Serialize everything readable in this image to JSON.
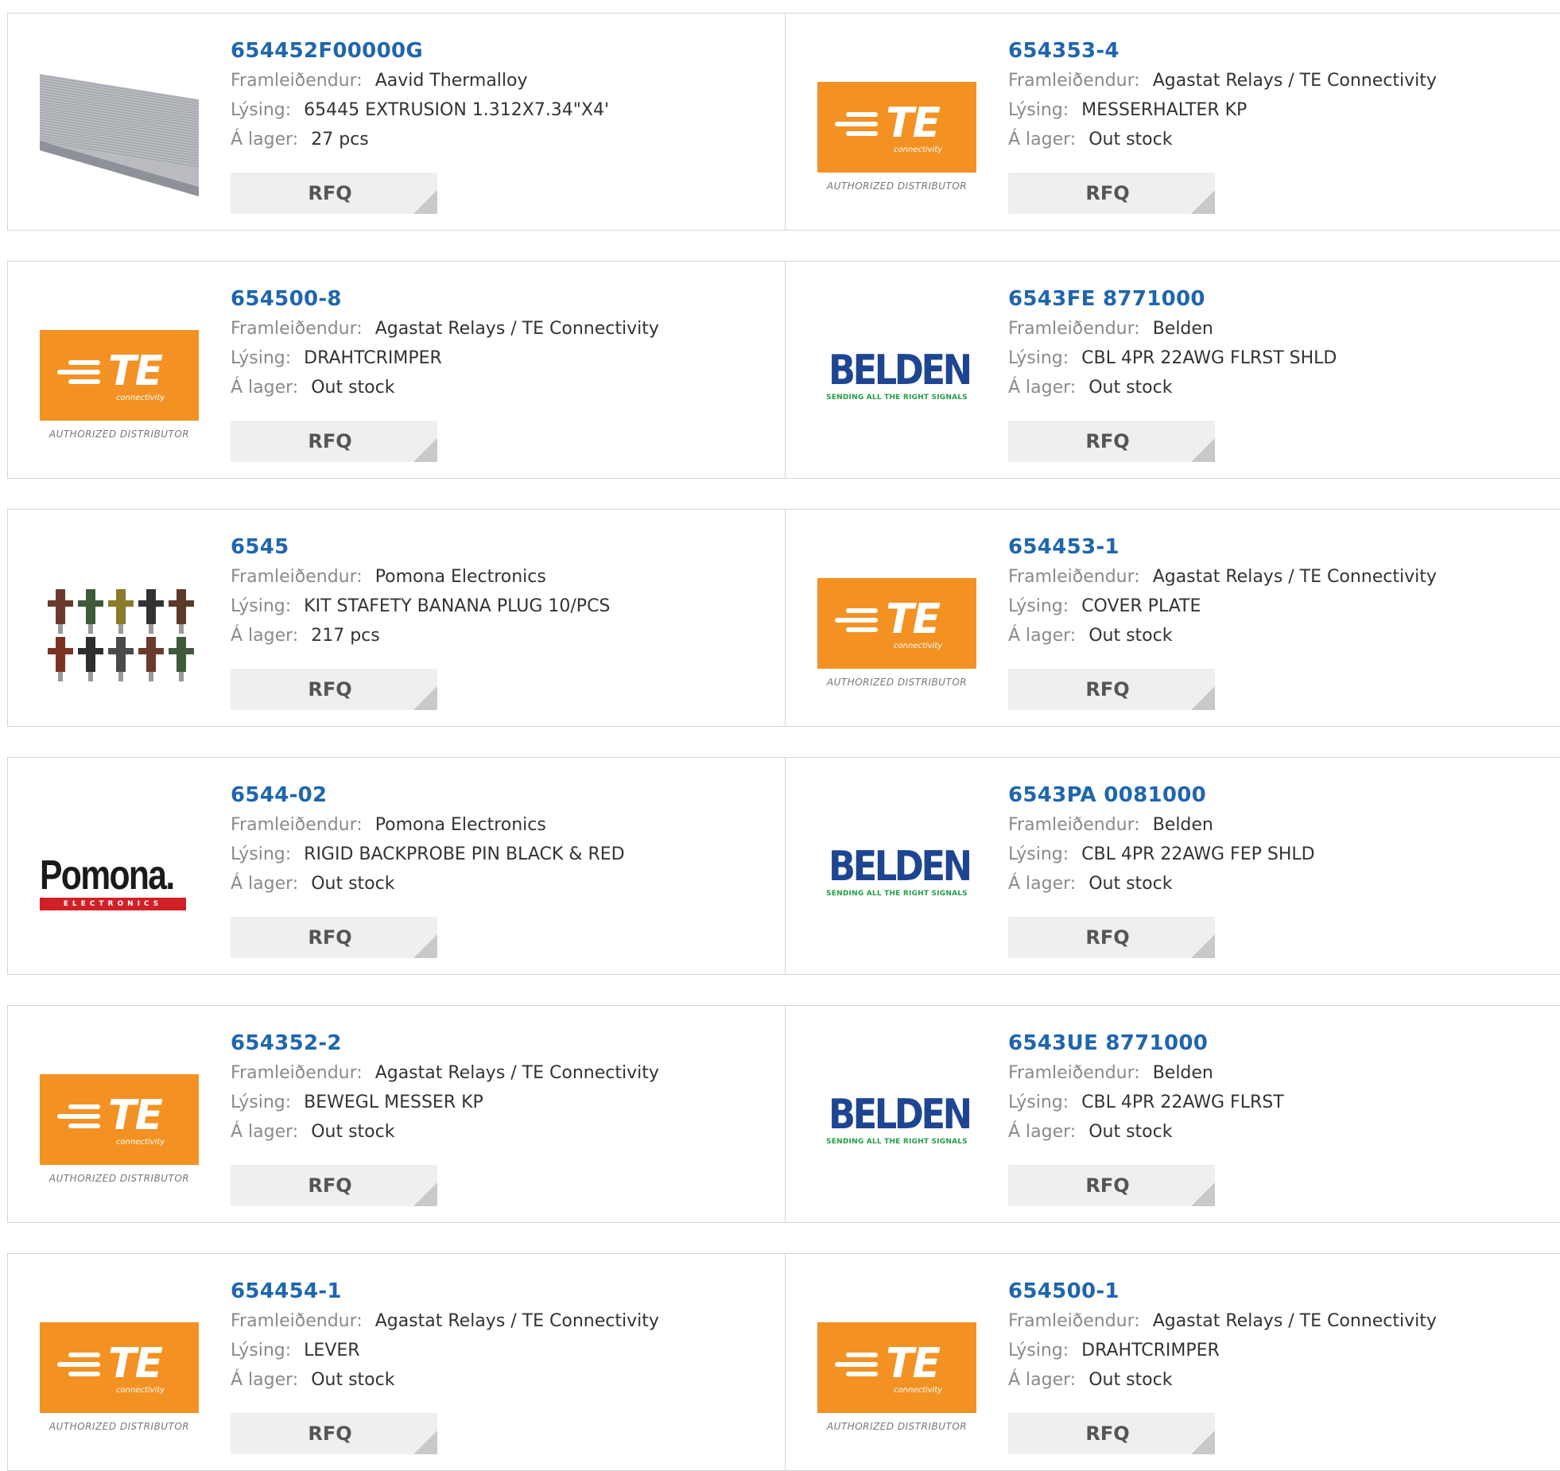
{
  "labels": {
    "manufacturer": "Framleiðendur:",
    "description": "Lýsing:",
    "stock": "Á lager:",
    "rfq": "RFQ"
  },
  "logos": {
    "te": {
      "word": "TE",
      "sub": "connectivity",
      "caption": "AUTHORIZED DISTRIBUTOR"
    },
    "belden": {
      "word": "BELDEN",
      "sub": "SENDING ALL THE RIGHT SIGNALS"
    },
    "pomona": {
      "word": "Pomona.",
      "sub": "ELECTRONICS"
    }
  },
  "products": [
    {
      "pn": "654452F00000G",
      "manufacturer": "Aavid Thermalloy",
      "description": "65445 EXTRUSION 1.312X7.34\"X4'",
      "stock": "27 pcs",
      "image": "heatsink-extrusion"
    },
    {
      "pn": "654353-4",
      "manufacturer": "Agastat Relays / TE Connectivity",
      "description": "MESSERHALTER KP",
      "stock": "Out stock",
      "image": "te-logo"
    },
    {
      "pn": "654500-8",
      "manufacturer": "Agastat Relays / TE Connectivity",
      "description": "DRAHTCRIMPER",
      "stock": "Out stock",
      "image": "te-logo"
    },
    {
      "pn": "6543FE 8771000",
      "manufacturer": "Belden",
      "description": "CBL 4PR 22AWG FLRST SHLD",
      "stock": "Out stock",
      "image": "belden-logo"
    },
    {
      "pn": "6545",
      "manufacturer": "Pomona Electronics",
      "description": "KIT STAFETY BANANA PLUG 10/PCS",
      "stock": "217 pcs",
      "image": "banana-plugs"
    },
    {
      "pn": "654453-1",
      "manufacturer": "Agastat Relays / TE Connectivity",
      "description": "COVER PLATE",
      "stock": "Out stock",
      "image": "te-logo"
    },
    {
      "pn": "6544-02",
      "manufacturer": "Pomona Electronics",
      "description": "RIGID BACKPROBE PIN BLACK & RED",
      "stock": "Out stock",
      "image": "pomona-logo"
    },
    {
      "pn": "6543PA 0081000",
      "manufacturer": "Belden",
      "description": "CBL 4PR 22AWG FEP SHLD",
      "stock": "Out stock",
      "image": "belden-logo"
    },
    {
      "pn": "654352-2",
      "manufacturer": "Agastat Relays / TE Connectivity",
      "description": "BEWEGL MESSER KP",
      "stock": "Out stock",
      "image": "te-logo"
    },
    {
      "pn": "6543UE 8771000",
      "manufacturer": "Belden",
      "description": "CBL 4PR 22AWG FLRST",
      "stock": "Out stock",
      "image": "belden-logo"
    },
    {
      "pn": "654454-1",
      "manufacturer": "Agastat Relays / TE Connectivity",
      "description": "LEVER",
      "stock": "Out stock",
      "image": "te-logo"
    },
    {
      "pn": "654500-1",
      "manufacturer": "Agastat Relays / TE Connectivity",
      "description": "DRAHTCRIMPER",
      "stock": "Out stock",
      "image": "te-logo"
    }
  ],
  "colors": {
    "link": "#1f66ad",
    "te_orange": "#f39123",
    "belden_blue": "#1e4592",
    "belden_green": "#23a04a",
    "pomona_red": "#d31f26"
  }
}
